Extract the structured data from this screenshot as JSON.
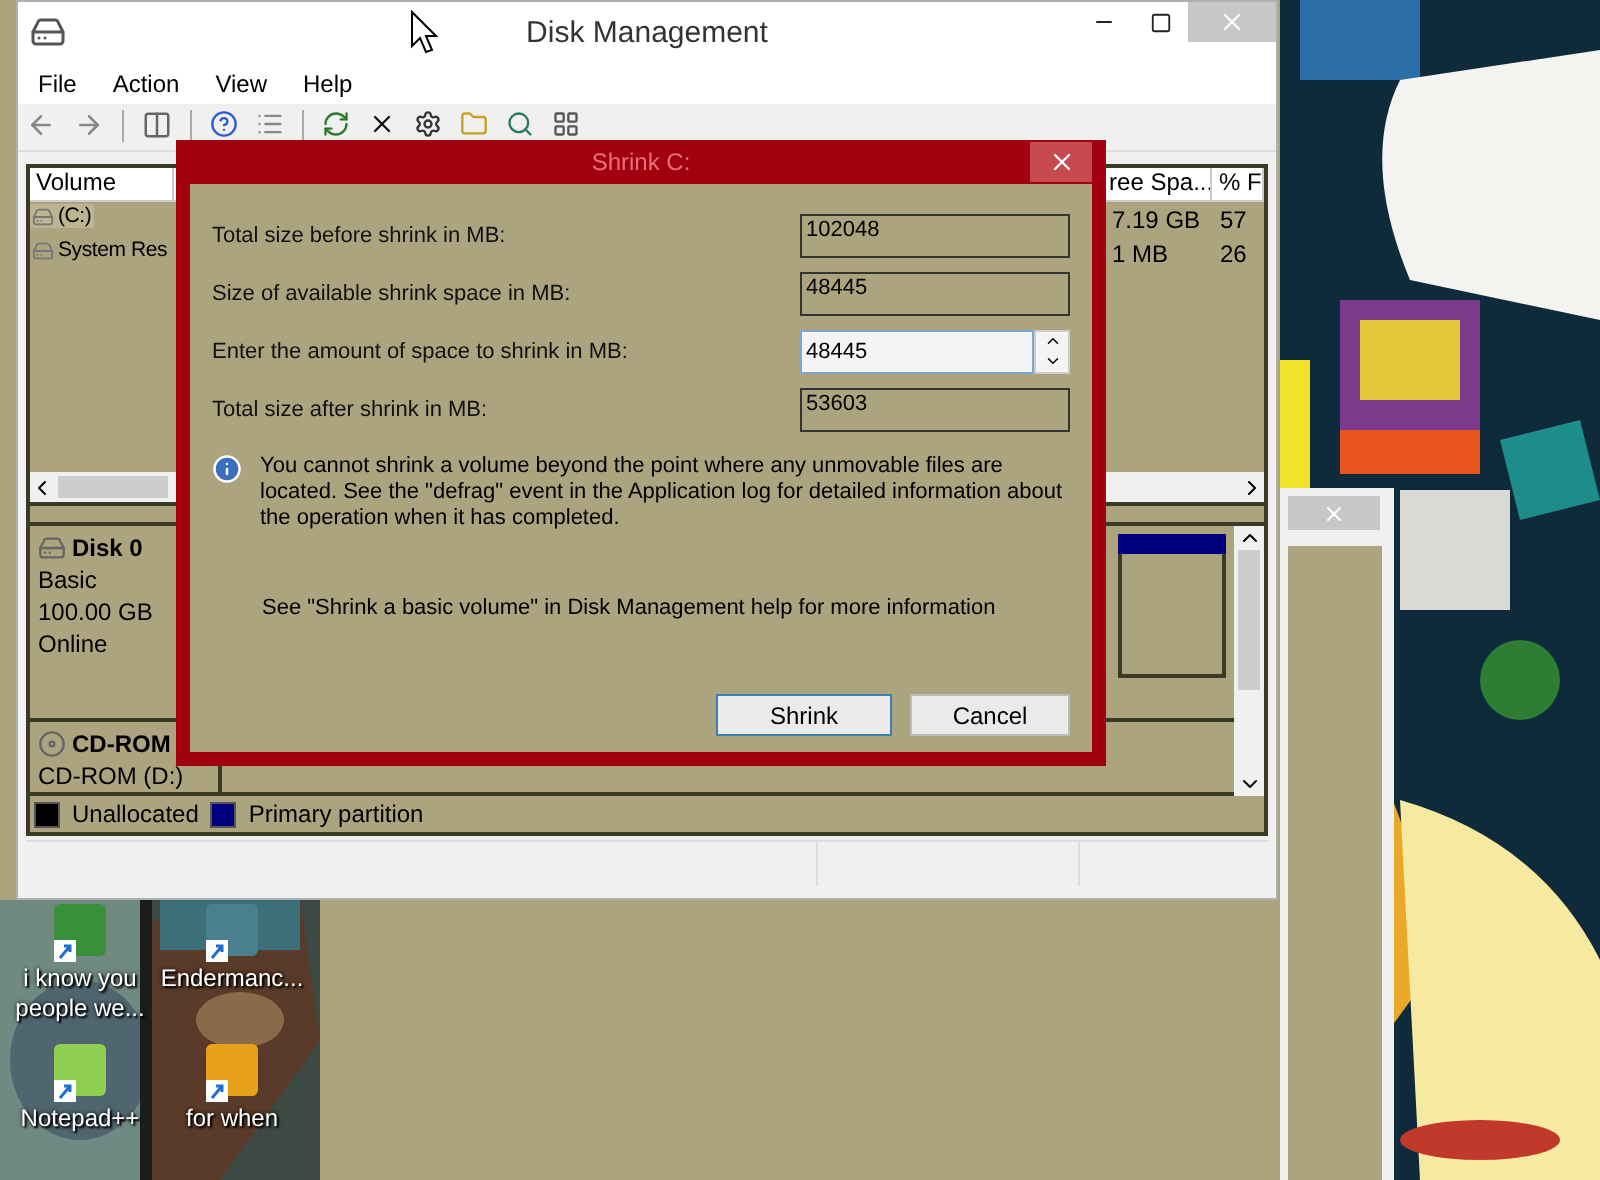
{
  "window": {
    "title": "Disk Management"
  },
  "menu": [
    "File",
    "Action",
    "View",
    "Help"
  ],
  "volume_list": {
    "columns": [
      "Volume",
      "ree Spa...",
      "% F"
    ],
    "rows": [
      {
        "volume": "(C:)",
        "free_space": "7.19 GB",
        "percent_free": "57",
        "selected": true
      },
      {
        "volume": "System Res",
        "free_space": "1 MB",
        "percent_free": "26",
        "selected": false
      }
    ]
  },
  "disks": [
    {
      "kind": "disk",
      "name": "Disk 0",
      "details": [
        "Basic",
        "100.00 GB",
        "Online"
      ]
    },
    {
      "kind": "cdrom",
      "name": "CD-ROM",
      "details": [
        "CD-ROM (D:)"
      ]
    }
  ],
  "legend": [
    {
      "label": "Unallocated",
      "color": "#000000"
    },
    {
      "label": "Primary partition",
      "color": "#000080"
    }
  ],
  "dialog": {
    "title": "Shrink C:",
    "fields": [
      {
        "kind": "readonly",
        "label": "Total size before shrink in MB:",
        "value": "102048"
      },
      {
        "kind": "readonly",
        "label": "Size of available shrink space in MB:",
        "value": "48445"
      },
      {
        "kind": "spin",
        "label": "Enter the amount of space to shrink in MB:",
        "value": "48445"
      },
      {
        "kind": "readonly",
        "label": "Total size after shrink in MB:",
        "value": "53603"
      }
    ],
    "info": "You cannot shrink a volume beyond the point where any unmovable files are located. See the \"defrag\" event in the Application log for detailed information about the operation when it has completed.",
    "help": "See \"Shrink a basic volume\" in Disk Management help for more information",
    "buttons": [
      {
        "label": "Shrink",
        "default": true
      },
      {
        "label": "Cancel",
        "default": false
      }
    ]
  },
  "desktop_icons": [
    {
      "label": "i know you people we..."
    },
    {
      "label": "Endermanc..."
    },
    {
      "label": "Notepad++"
    },
    {
      "label": "for when"
    }
  ]
}
